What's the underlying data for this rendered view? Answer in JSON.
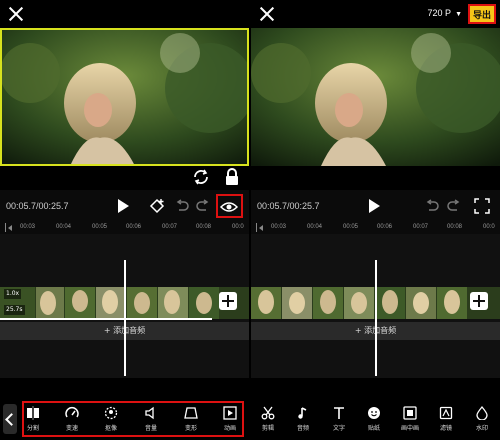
{
  "left": {
    "time": "00:05.7/00:25.7",
    "ruler": [
      "00:03",
      "00:04",
      "00:05",
      "00:06",
      "00:07",
      "00:08",
      "00:0"
    ],
    "clip_speed": "1.0x",
    "clip_duration": "25.7s",
    "add_audio": "+ 添加音频",
    "tools": [
      "分割",
      "变速",
      "抠像",
      "音量",
      "变形",
      "动画"
    ],
    "icons": [
      "split-icon",
      "speed-icon",
      "cutout-icon",
      "volume-icon",
      "transform-icon",
      "animation-icon"
    ]
  },
  "right": {
    "resolution": "720 P",
    "export_label": "导出",
    "time": "00:05.7/00:25.7",
    "ruler": [
      "00:03",
      "00:04",
      "00:05",
      "00:06",
      "00:07",
      "00:08",
      "00:0"
    ],
    "add_audio": "+ 添加音频",
    "tools": [
      "剪辑",
      "音频",
      "文字",
      "贴纸",
      "画中画",
      "滤镜",
      "水印"
    ],
    "icons": [
      "scissors-icon",
      "music-icon",
      "text-icon",
      "sticker-icon",
      "pip-icon",
      "filter-icon",
      "watermark-icon"
    ]
  },
  "colors": {
    "export_bg": "#f5c518",
    "highlight": "#dd1111",
    "selection": "#d7e21e"
  }
}
